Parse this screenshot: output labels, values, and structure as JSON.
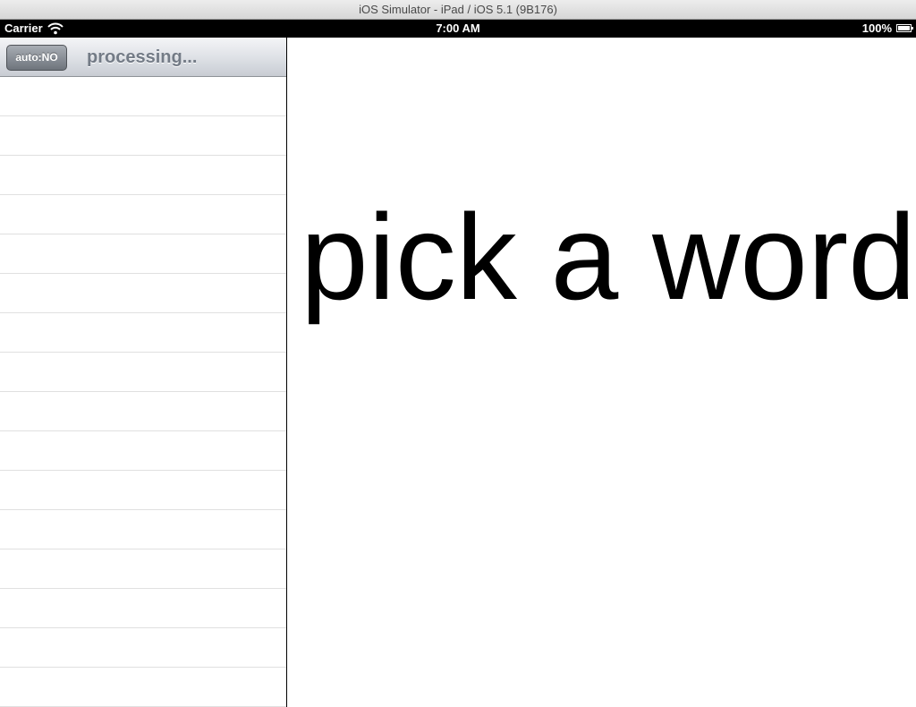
{
  "window": {
    "title": "iOS Simulator - iPad / iOS 5.1 (9B176)"
  },
  "status_bar": {
    "carrier": "Carrier",
    "time": "7:00 AM",
    "battery": "100%",
    "battery_level": 1.0
  },
  "master": {
    "auto_button_label": "auto:NO",
    "title": "processing...",
    "rows": [
      "",
      "",
      "",
      "",
      "",
      "",
      "",
      "",
      "",
      "",
      "",
      "",
      "",
      "",
      "",
      ""
    ]
  },
  "detail": {
    "word": "pick a word"
  }
}
